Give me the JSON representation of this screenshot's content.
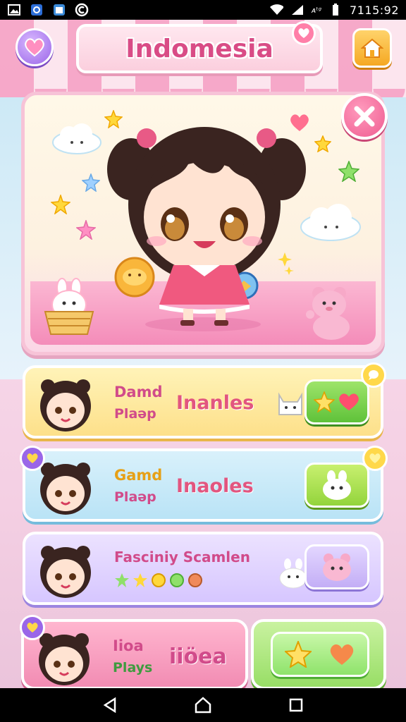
{
  "status_bar": {
    "carrier": "ᴀᵗᵍ",
    "time": "7115:92"
  },
  "header": {
    "title": "Indomesia"
  },
  "rows": [
    {
      "line1": "Damd",
      "line2": "Plaəp",
      "main": "Inanles"
    },
    {
      "line1": "Gamd",
      "line2": "Plaəp",
      "main": "Inaoles"
    },
    {
      "line1": "Fasciniy Scamlen"
    },
    {
      "line1": "Iioa",
      "line2": "Plays",
      "main": "iiöea"
    }
  ],
  "colors": {
    "accent": "#e2557f",
    "brand_pink": "#f48cb9",
    "bar": "#000000"
  }
}
